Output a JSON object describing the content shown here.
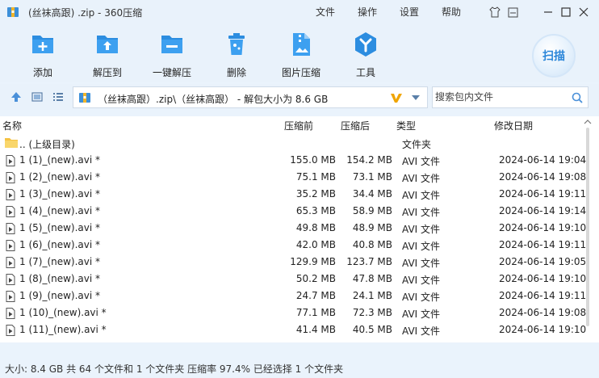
{
  "window": {
    "title": "(丝袜高跟) .zip - 360压缩",
    "menus": [
      "文件",
      "操作",
      "设置",
      "帮助"
    ]
  },
  "toolbar": {
    "tools": [
      {
        "label": "添加",
        "icon": "add-icon"
      },
      {
        "label": "解压到",
        "icon": "extract-to-icon"
      },
      {
        "label": "一键解压",
        "icon": "one-click-extract-icon"
      },
      {
        "label": "删除",
        "icon": "trash-icon"
      },
      {
        "label": "图片压缩",
        "icon": "image-compress-icon"
      },
      {
        "label": "工具",
        "icon": "tools-icon"
      }
    ],
    "scan_label": "扫描"
  },
  "address": {
    "path": "（丝袜高跟）.zip\\（丝袜高跟） - 解包大小为 8.6 GB",
    "search_placeholder": "搜索包内文件"
  },
  "columns": {
    "name": "名称",
    "compressed_before": "压缩前",
    "compressed_after": "压缩后",
    "type": "类型",
    "modified": "修改日期"
  },
  "parent_row": {
    "name": ".. (上级目录)",
    "type": "文件夹"
  },
  "rows": [
    {
      "name": "1 (1)_(new).avi *",
      "before": "155.0 MB",
      "after": "154.2 MB",
      "type": "AVI 文件",
      "date": "2024-06-14 19:04"
    },
    {
      "name": "1 (2)_(new).avi *",
      "before": "75.1 MB",
      "after": "73.1 MB",
      "type": "AVI 文件",
      "date": "2024-06-14 19:08"
    },
    {
      "name": "1 (3)_(new).avi *",
      "before": "35.2 MB",
      "after": "34.4 MB",
      "type": "AVI 文件",
      "date": "2024-06-14 19:11"
    },
    {
      "name": "1 (4)_(new).avi *",
      "before": "65.3 MB",
      "after": "58.9 MB",
      "type": "AVI 文件",
      "date": "2024-06-14 19:14"
    },
    {
      "name": "1 (5)_(new).avi *",
      "before": "49.8 MB",
      "after": "48.9 MB",
      "type": "AVI 文件",
      "date": "2024-06-14 19:10"
    },
    {
      "name": "1 (6)_(new).avi *",
      "before": "42.0 MB",
      "after": "40.8 MB",
      "type": "AVI 文件",
      "date": "2024-06-14 19:11"
    },
    {
      "name": "1 (7)_(new).avi *",
      "before": "129.9 MB",
      "after": "123.7 MB",
      "type": "AVI 文件",
      "date": "2024-06-14 19:05"
    },
    {
      "name": "1 (8)_(new).avi *",
      "before": "50.2 MB",
      "after": "47.8 MB",
      "type": "AVI 文件",
      "date": "2024-06-14 19:10"
    },
    {
      "name": "1 (9)_(new).avi *",
      "before": "24.7 MB",
      "after": "24.1 MB",
      "type": "AVI 文件",
      "date": "2024-06-14 19:11"
    },
    {
      "name": "1 (10)_(new).avi *",
      "before": "77.1 MB",
      "after": "72.3 MB",
      "type": "AVI 文件",
      "date": "2024-06-14 19:08"
    },
    {
      "name": "1 (11)_(new).avi *",
      "before": "41.4 MB",
      "after": "40.5 MB",
      "type": "AVI 文件",
      "date": "2024-06-14 19:10"
    }
  ],
  "status": {
    "text": "大小: 8.4 GB 共 64 个文件和 1 个文件夹 压缩率 97.4% 已经选择 1 个文件夹"
  }
}
